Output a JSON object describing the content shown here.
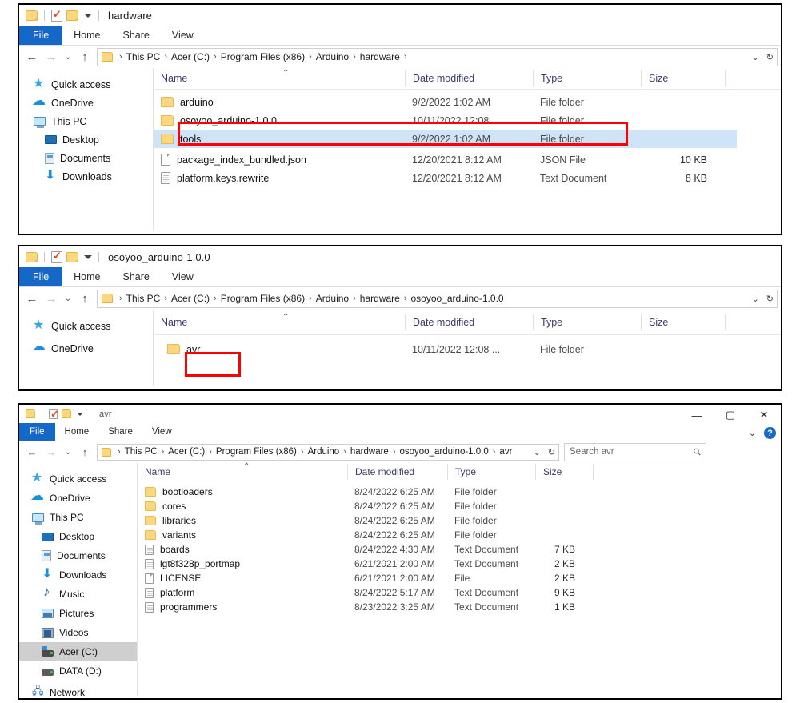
{
  "windows": [
    {
      "id": "hardware",
      "title": "hardware",
      "tabs": [
        "File",
        "Home",
        "Share",
        "View"
      ],
      "breadcrumbs": [
        "This PC",
        "Acer (C:)",
        "Program Files (x86)",
        "Arduino",
        "hardware",
        ""
      ],
      "columns": [
        "Name",
        "Date modified",
        "Type",
        "Size"
      ],
      "sidebar": [
        {
          "label": "Quick access",
          "icon": "star-icon",
          "indent": false,
          "selected": false
        },
        {
          "label": "OneDrive",
          "icon": "cloud-icon",
          "indent": false,
          "selected": false
        },
        {
          "label": "This PC",
          "icon": "computer-icon",
          "indent": false,
          "selected": false
        },
        {
          "label": "Desktop",
          "icon": "desktop-icon",
          "indent": true,
          "selected": false
        },
        {
          "label": "Documents",
          "icon": "documents-icon",
          "indent": true,
          "selected": false
        },
        {
          "label": "Downloads",
          "icon": "download-icon",
          "indent": true,
          "selected": false
        }
      ],
      "rows": [
        {
          "name": "arduino",
          "date": "9/2/2022 1:02 AM",
          "type": "File folder",
          "size": "",
          "icon": "folder-icon",
          "selected": false
        },
        {
          "name": "osoyoo_arduino-1.0.0",
          "date": "10/11/2022 12:08 ...",
          "type": "File folder",
          "size": "",
          "icon": "folder-icon",
          "selected": false
        },
        {
          "name": "tools",
          "date": "9/2/2022 1:02 AM",
          "type": "File folder",
          "size": "",
          "icon": "folder-icon",
          "selected": true
        },
        {
          "name": "package_index_bundled.json",
          "date": "12/20/2021 8:12 AM",
          "type": "JSON File",
          "size": "10 KB",
          "icon": "json-file-icon",
          "selected": false
        },
        {
          "name": "platform.keys.rewrite",
          "date": "12/20/2021 8:12 AM",
          "type": "Text Document",
          "size": "8 KB",
          "icon": "text-file-icon",
          "selected": false
        }
      ]
    },
    {
      "id": "osoyoo",
      "title": "osoyoo_arduino-1.0.0",
      "tabs": [
        "File",
        "Home",
        "Share",
        "View"
      ],
      "breadcrumbs": [
        "This PC",
        "Acer (C:)",
        "Program Files (x86)",
        "Arduino",
        "hardware",
        "osoyoo_arduino-1.0.0"
      ],
      "columns": [
        "Name",
        "Date modified",
        "Type",
        "Size"
      ],
      "sidebar": [
        {
          "label": "Quick access",
          "icon": "star-icon",
          "indent": false,
          "selected": false
        },
        {
          "label": "OneDrive",
          "icon": "cloud-icon",
          "indent": false,
          "selected": false
        }
      ],
      "rows": [
        {
          "name": "avr",
          "date": "10/11/2022 12:08 ...",
          "type": "File folder",
          "size": "",
          "icon": "folder-icon",
          "selected": false
        }
      ]
    },
    {
      "id": "avr",
      "title": "avr",
      "tabs": [
        "File",
        "Home",
        "Share",
        "View"
      ],
      "breadcrumbs": [
        "This PC",
        "Acer (C:)",
        "Program Files (x86)",
        "Arduino",
        "hardware",
        "osoyoo_arduino-1.0.0",
        "avr"
      ],
      "search_placeholder": "Search avr",
      "window_controls": [
        "minimize",
        "maximize",
        "close"
      ],
      "columns": [
        "Name",
        "Date modified",
        "Type",
        "Size"
      ],
      "sidebar": [
        {
          "label": "Quick access",
          "icon": "star-icon",
          "indent": false,
          "selected": false
        },
        {
          "label": "OneDrive",
          "icon": "cloud-icon",
          "indent": false,
          "selected": false
        },
        {
          "label": "This PC",
          "icon": "computer-icon",
          "indent": false,
          "selected": false
        },
        {
          "label": "Desktop",
          "icon": "desktop-icon",
          "indent": true,
          "selected": false
        },
        {
          "label": "Documents",
          "icon": "documents-icon",
          "indent": true,
          "selected": false
        },
        {
          "label": "Downloads",
          "icon": "download-icon",
          "indent": true,
          "selected": false
        },
        {
          "label": "Music",
          "icon": "music-icon",
          "indent": true,
          "selected": false
        },
        {
          "label": "Pictures",
          "icon": "pictures-icon",
          "indent": true,
          "selected": false
        },
        {
          "label": "Videos",
          "icon": "videos-icon",
          "indent": true,
          "selected": false
        },
        {
          "label": "Acer (C:)",
          "icon": "system-drive-icon",
          "indent": true,
          "selected": true
        },
        {
          "label": "DATA (D:)",
          "icon": "drive-icon",
          "indent": true,
          "selected": false
        },
        {
          "label": "Network",
          "icon": "network-icon",
          "indent": false,
          "selected": false
        }
      ],
      "rows": [
        {
          "name": "bootloaders",
          "date": "8/24/2022 6:25 AM",
          "type": "File folder",
          "size": "",
          "icon": "folder-icon",
          "selected": false
        },
        {
          "name": "cores",
          "date": "8/24/2022 6:25 AM",
          "type": "File folder",
          "size": "",
          "icon": "folder-icon",
          "selected": false
        },
        {
          "name": "libraries",
          "date": "8/24/2022 6:25 AM",
          "type": "File folder",
          "size": "",
          "icon": "folder-icon",
          "selected": false
        },
        {
          "name": "variants",
          "date": "8/24/2022 6:25 AM",
          "type": "File folder",
          "size": "",
          "icon": "folder-icon",
          "selected": false
        },
        {
          "name": "boards",
          "date": "8/24/2022 4:30 AM",
          "type": "Text Document",
          "size": "7 KB",
          "icon": "text-file-icon",
          "selected": false
        },
        {
          "name": "lgt8f328p_portmap",
          "date": "6/21/2021 2:00 AM",
          "type": "Text Document",
          "size": "2 KB",
          "icon": "text-file-icon",
          "selected": false
        },
        {
          "name": "LICENSE",
          "date": "6/21/2021 2:00 AM",
          "type": "File",
          "size": "2 KB",
          "icon": "generic-file-icon",
          "selected": false
        },
        {
          "name": "platform",
          "date": "8/24/2022 5:17 AM",
          "type": "Text Document",
          "size": "9 KB",
          "icon": "text-file-icon",
          "selected": false
        },
        {
          "name": "programmers",
          "date": "8/23/2022 3:25 AM",
          "type": "Text Document",
          "size": "1 KB",
          "icon": "text-file-icon",
          "selected": false
        }
      ]
    }
  ],
  "colors": {
    "accent": "#1668c8",
    "annotation": "#ff0000",
    "selection": "#cfe4f7",
    "nav_selection": "#cfcfcf",
    "folder": "#fcd77f"
  },
  "annotations": [
    {
      "target": "osoyoo_arduino-1.0.0 row",
      "color": "#ff0000"
    },
    {
      "target": "avr row",
      "color": "#ff0000"
    }
  ]
}
